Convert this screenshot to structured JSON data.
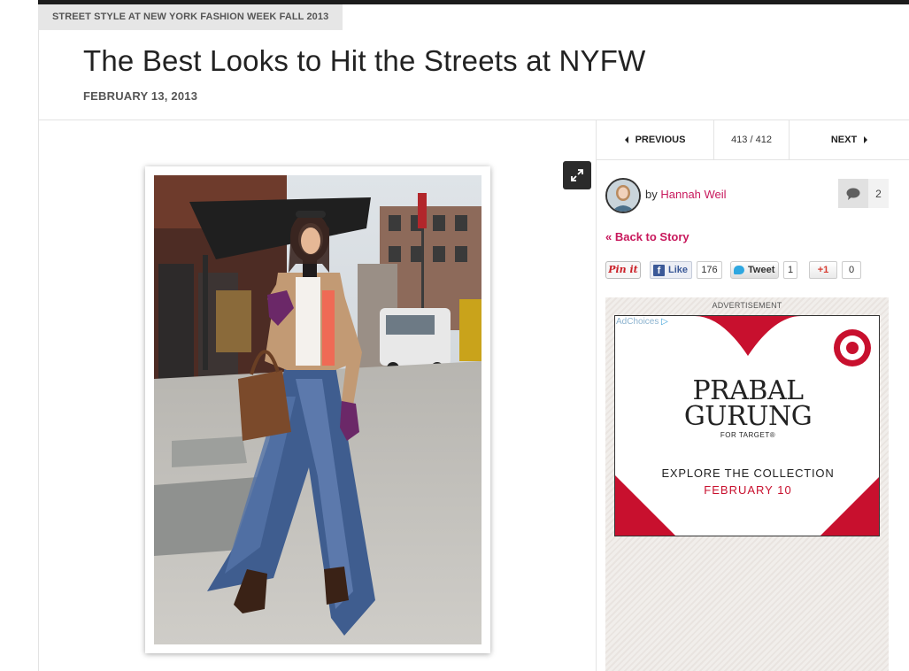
{
  "header": {
    "kicker": "STREET STYLE AT NEW YORK FASHION WEEK FALL 2013",
    "title": "The Best Looks to Hit the Streets at NYFW",
    "date": "FEBRUARY 13, 2013"
  },
  "gallery_nav": {
    "previous_label": "PREVIOUS",
    "counter": "413 / 412",
    "next_label": "NEXT"
  },
  "author": {
    "by": "by",
    "name": "Hannah Weil",
    "comment_count": "2"
  },
  "back_link": "« Back to Story",
  "social": {
    "pinit_label": "Pin it",
    "like_label": "Like",
    "like_count": "176",
    "tweet_label": "Tweet",
    "tweet_count": "1",
    "gplus_label": "+1",
    "gplus_count": "0"
  },
  "ad": {
    "label": "ADVERTISEMENT",
    "adchoices": "AdChoices",
    "brand_line1": "PRABAL",
    "brand_line2": "GURUNG",
    "brand_sub": "FOR TARGET®",
    "cta": "EXPLORE THE COLLECTION",
    "cta_date": "FEBRUARY 10",
    "accent_color": "#c8102e"
  },
  "icons": {
    "expand": "expand-icon",
    "comment": "comment-bubble-icon",
    "target": "target-logo-icon"
  }
}
